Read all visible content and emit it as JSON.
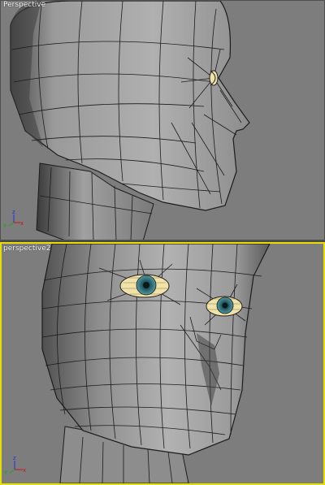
{
  "viewports": [
    {
      "label": "Perspective",
      "active": false
    },
    {
      "label": "perspective2",
      "active": true
    }
  ],
  "axis": {
    "x": "x",
    "y": "y",
    "z": "z"
  },
  "colors": {
    "viewport_bg": "#7d7d7d",
    "active_border": "#e6e000",
    "mesh_face": "#a8a8a8",
    "mesh_edge": "#1c1c1c",
    "axis_x": "#d01010",
    "axis_y": "#10b010",
    "axis_z": "#2030e0",
    "iris": "#2e6f78",
    "eye_white": "#f0e2a8"
  },
  "icons": [
    "axis-tripod-icon"
  ]
}
